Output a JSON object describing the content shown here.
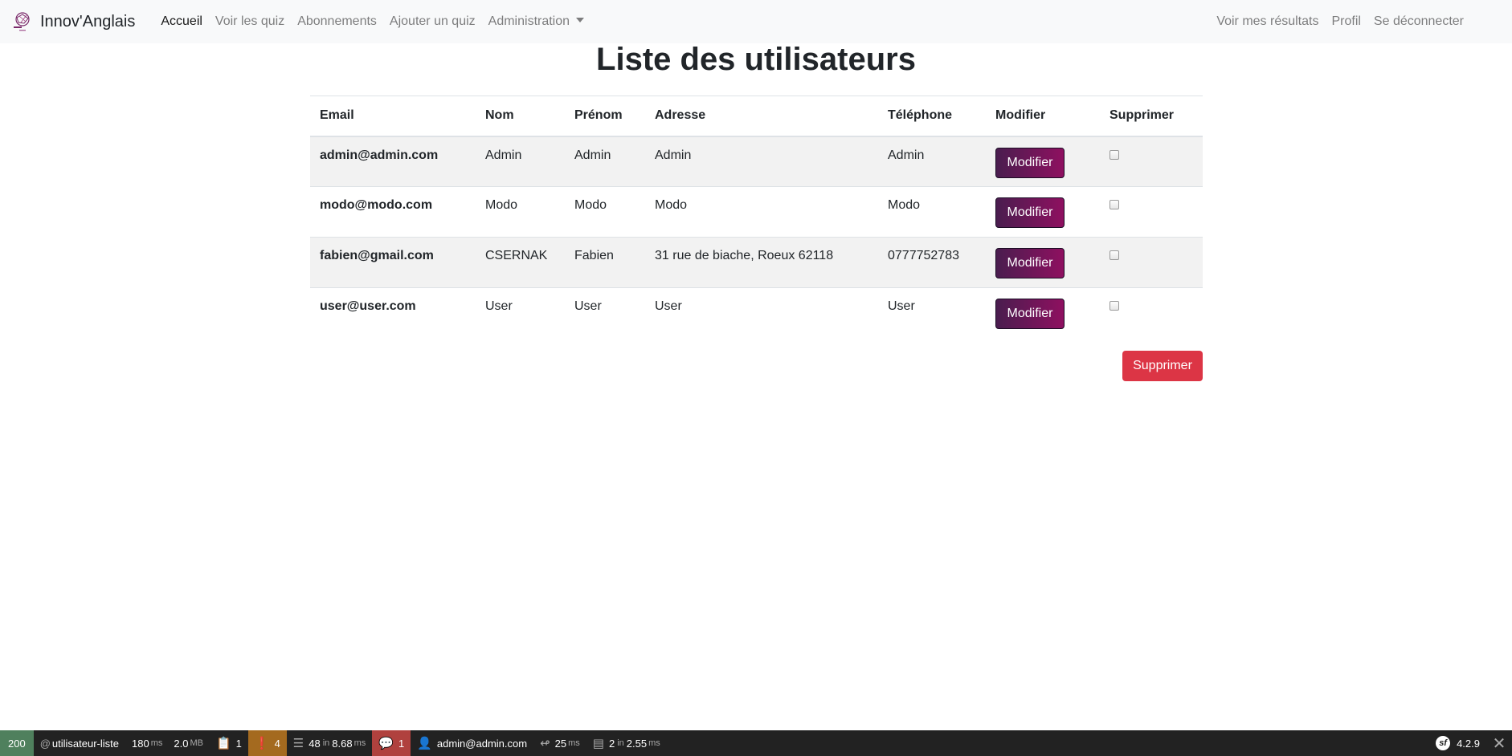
{
  "navbar": {
    "brand": "Innov'Anglais",
    "left_links": [
      {
        "label": "Accueil",
        "active": true
      },
      {
        "label": "Voir les quiz"
      },
      {
        "label": "Abonnements"
      },
      {
        "label": "Ajouter un quiz"
      },
      {
        "label": "Administration"
      }
    ],
    "right_links": [
      {
        "label": "Voir mes résultats"
      },
      {
        "label": "Profil"
      },
      {
        "label": "Se déconnecter"
      }
    ]
  },
  "page": {
    "title": "Liste des utilisateurs"
  },
  "table": {
    "headers": [
      "Email",
      "Nom",
      "Prénom",
      "Adresse",
      "Téléphone",
      "Modifier",
      "Supprimer"
    ],
    "rows": [
      {
        "email": "admin@admin.com",
        "nom": "Admin",
        "prenom": "Admin",
        "adresse": "Admin",
        "telephone": "Admin",
        "modifier": "Modifier"
      },
      {
        "email": "modo@modo.com",
        "nom": "Modo",
        "prenom": "Modo",
        "adresse": "Modo",
        "telephone": "Modo",
        "modifier": "Modifier"
      },
      {
        "email": "fabien@gmail.com",
        "nom": "CSERNAK",
        "prenom": "Fabien",
        "adresse": "31 rue de biache, Roeux 62118",
        "telephone": "0777752783",
        "modifier": "Modifier"
      },
      {
        "email": "user@user.com",
        "nom": "User",
        "prenom": "User",
        "adresse": "User",
        "telephone": "User",
        "modifier": "Modifier"
      }
    ]
  },
  "actions": {
    "delete_label": "Supprimer"
  },
  "toolbar": {
    "status": "200",
    "route": "utilisateur-liste",
    "time_value": "180",
    "time_unit": "ms",
    "memory_value": "2.0",
    "memory_unit": "MB",
    "forms_count": "1",
    "logs_count": "4",
    "cache_value": "48",
    "cache_in": "in",
    "cache_time": "8.68",
    "cache_unit": "ms",
    "translation_count": "1",
    "user": "admin@admin.com",
    "twig_value": "25",
    "twig_unit": "ms",
    "db_value": "2",
    "db_in": "in",
    "db_time": "2.55",
    "db_unit": "ms",
    "symfony_version": "4.2.9"
  }
}
